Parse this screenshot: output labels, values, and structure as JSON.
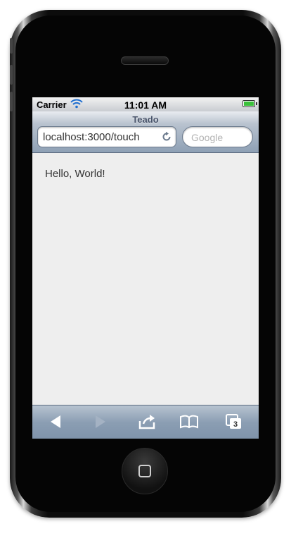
{
  "status_bar": {
    "carrier": "Carrier",
    "time": "11:01 AM",
    "wifi_icon": "wifi-icon",
    "battery_icon": "battery-icon"
  },
  "browser": {
    "page_title": "Teado",
    "url": "localhost:3000/touch",
    "search_placeholder": "Google",
    "reload_icon": "reload-icon"
  },
  "content": {
    "text": "Hello, World!"
  },
  "toolbar": {
    "back_icon": "back-arrow-icon",
    "forward_icon": "forward-arrow-icon",
    "share_icon": "share-icon",
    "bookmarks_icon": "bookmarks-icon",
    "pages_icon": "pages-icon",
    "pages_count": "3"
  },
  "colors": {
    "screen_background": "#eeeeee",
    "toolbar": "#8b9eb3",
    "accent_battery": "#3bc13b"
  }
}
